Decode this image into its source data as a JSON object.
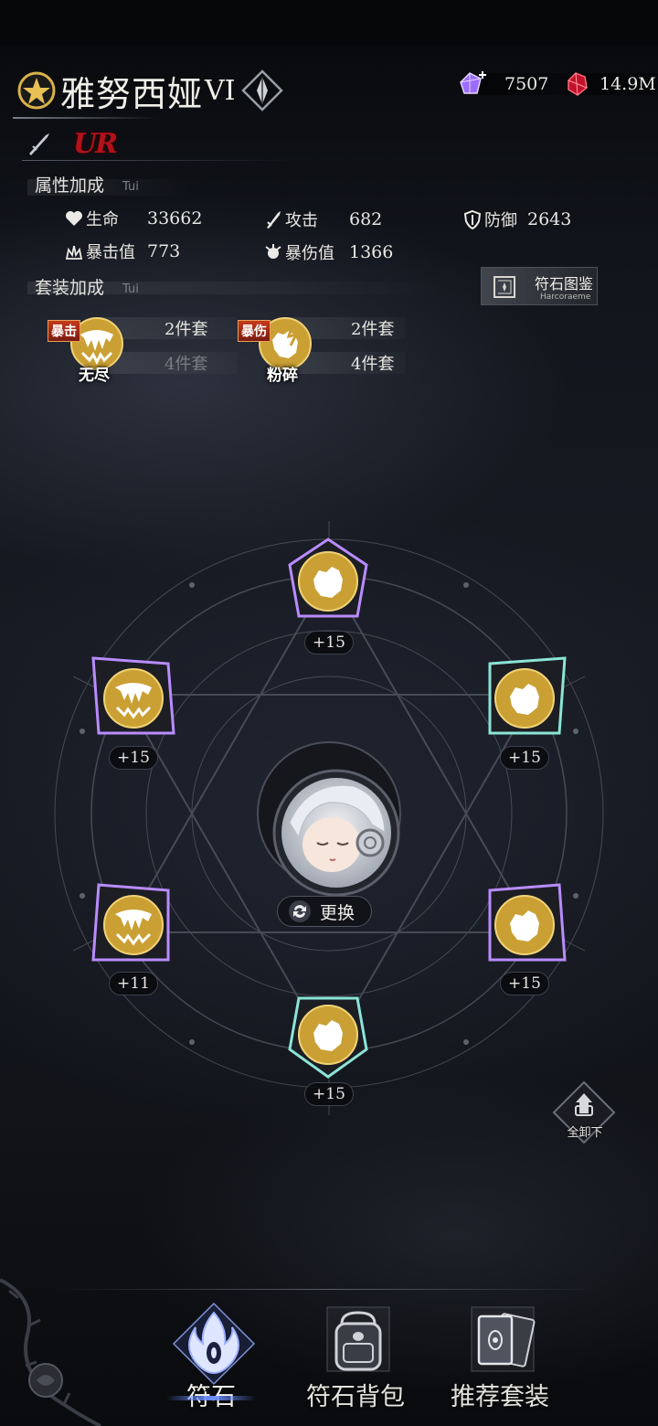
{
  "hero": {
    "name": "雅努西娅",
    "tier": "VI",
    "rarity": "UR"
  },
  "currency": {
    "gems": "7507",
    "crystals": "14.9M"
  },
  "attributes": {
    "title": "属性加成",
    "subtitle": "Tui",
    "stats": [
      {
        "label": "生命",
        "value": "33662",
        "icon": "heart-icon"
      },
      {
        "label": "攻击",
        "value": "682",
        "icon": "sword-icon"
      },
      {
        "label": "防御",
        "value": "2643",
        "icon": "shield-icon"
      },
      {
        "label": "暴击值",
        "value": "773",
        "icon": "crit-icon"
      },
      {
        "label": "暴伤值",
        "value": "1366",
        "icon": "crit-damage-icon"
      }
    ]
  },
  "set_bonus": {
    "title": "套装加成",
    "subtitle": "Tui",
    "sets": [
      {
        "tag": "暴击",
        "name": "无尽",
        "rows": [
          "2件套",
          "4件套"
        ]
      },
      {
        "tag": "暴伤",
        "name": "粉碎",
        "rows": [
          "2件套",
          "4件套"
        ]
      }
    ]
  },
  "codex": {
    "label": "符石图鉴",
    "sub": "Harcoraeme"
  },
  "slots": [
    {
      "level": "+15",
      "rune": "fist-rune"
    },
    {
      "level": "+15",
      "rune": "fist-rune"
    },
    {
      "level": "+15",
      "rune": "fist-rune"
    },
    {
      "level": "+15",
      "rune": "fist-rune"
    },
    {
      "level": "+11",
      "rune": "fang-rune"
    },
    {
      "level": "+15",
      "rune": "fang-rune"
    }
  ],
  "swap_label": "更换",
  "unequip_label": "全卸下",
  "nav": [
    {
      "label": "符石",
      "icon": "rune-flame-icon"
    },
    {
      "label": "符石背包",
      "icon": "backpack-icon"
    },
    {
      "label": "推荐套装",
      "icon": "cards-icon"
    }
  ],
  "colors": {
    "rarity": "#b3121a",
    "rune_gold": "#d9a632",
    "accent_blue": "#6a8cff"
  }
}
